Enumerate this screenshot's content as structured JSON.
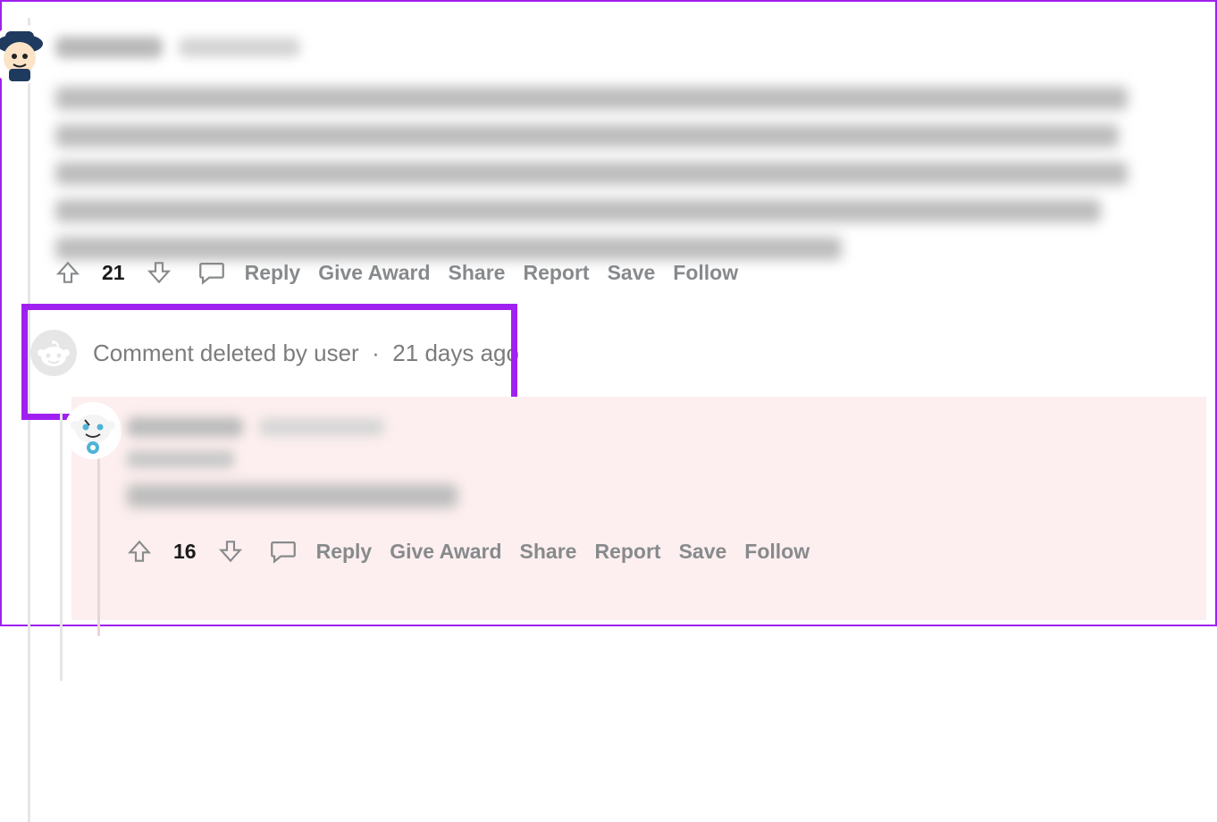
{
  "comment1": {
    "score": "21",
    "actions": {
      "reply": "Reply",
      "award": "Give Award",
      "share": "Share",
      "report": "Report",
      "save": "Save",
      "follow": "Follow"
    }
  },
  "deleted": {
    "text": "Comment deleted by user",
    "sep": "·",
    "time": "21 days ago"
  },
  "comment2": {
    "score": "16",
    "actions": {
      "reply": "Reply",
      "award": "Give Award",
      "share": "Share",
      "report": "Report",
      "save": "Save",
      "follow": "Follow"
    }
  }
}
